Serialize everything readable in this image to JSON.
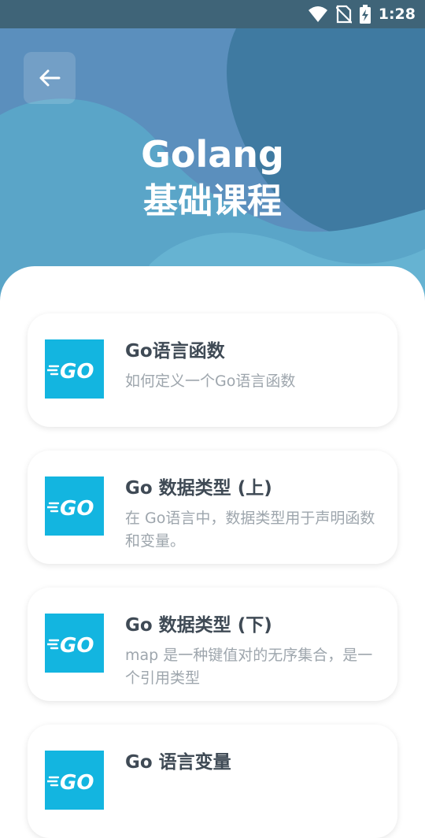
{
  "status_bar": {
    "time": "1:28",
    "icons": [
      "wifi-icon",
      "no-sim-icon",
      "battery-charging-icon"
    ]
  },
  "header": {
    "back_icon": "arrow-left-icon",
    "title_line1": "Golang",
    "title_line2": "基础课程"
  },
  "colors": {
    "hero_bg": "#5b8fbd",
    "status_bar": "#3f6478",
    "go_brand": "#13b5e0",
    "title_text": "#3f4a55",
    "desc_text": "#9ea6ad"
  },
  "courses": [
    {
      "logo": "GO",
      "title": "Go语言函数",
      "desc": "如何定义一个Go语言函数"
    },
    {
      "logo": "GO",
      "title": "Go 数据类型 (上)",
      "desc": "在 Go语言中，数据类型用于声明函数和变量。"
    },
    {
      "logo": "GO",
      "title": "Go 数据类型 (下)",
      "desc": "map 是一种键值对的无序集合，是一个引用类型"
    },
    {
      "logo": "GO",
      "title": "Go 语言变量",
      "desc": ""
    }
  ]
}
